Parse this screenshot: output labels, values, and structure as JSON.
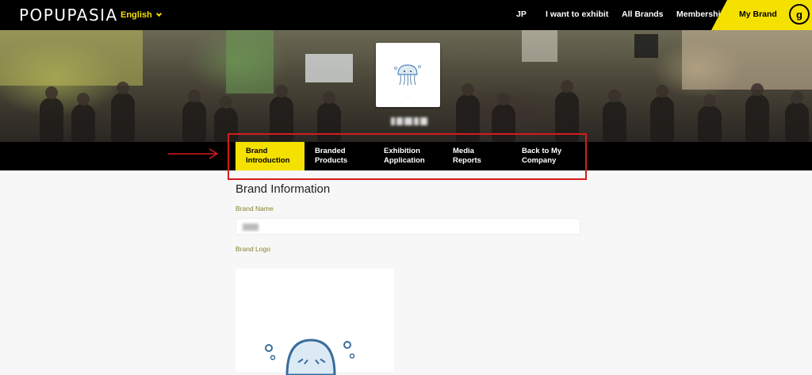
{
  "header": {
    "logo": "POPUPASIA",
    "language": "English",
    "nav": [
      "JP",
      "I want to exhibit",
      "All Brands",
      "Membership"
    ],
    "my_brand": "My Brand",
    "avatar_initial": "g"
  },
  "tabs": [
    {
      "line1": "Brand",
      "line2": "Introduction",
      "active": true
    },
    {
      "line1": "Branded",
      "line2": "Products",
      "active": false
    },
    {
      "line1": "Exhibition",
      "line2": "Application",
      "active": false
    },
    {
      "line1": "Media",
      "line2": "Reports",
      "active": false
    },
    {
      "line1": "Back to My",
      "line2": "Company",
      "active": false
    }
  ],
  "content": {
    "section_title": "Brand Information",
    "brand_name_label": "Brand Name",
    "brand_logo_label": "Brand Logo"
  },
  "colors": {
    "accent": "#f5e100",
    "highlight": "#d41c1c",
    "navbar": "#000000",
    "label": "#8a8130"
  },
  "icons": [
    "chevron-down-icon",
    "jellyfish-logo",
    "red-arrow-icon"
  ]
}
